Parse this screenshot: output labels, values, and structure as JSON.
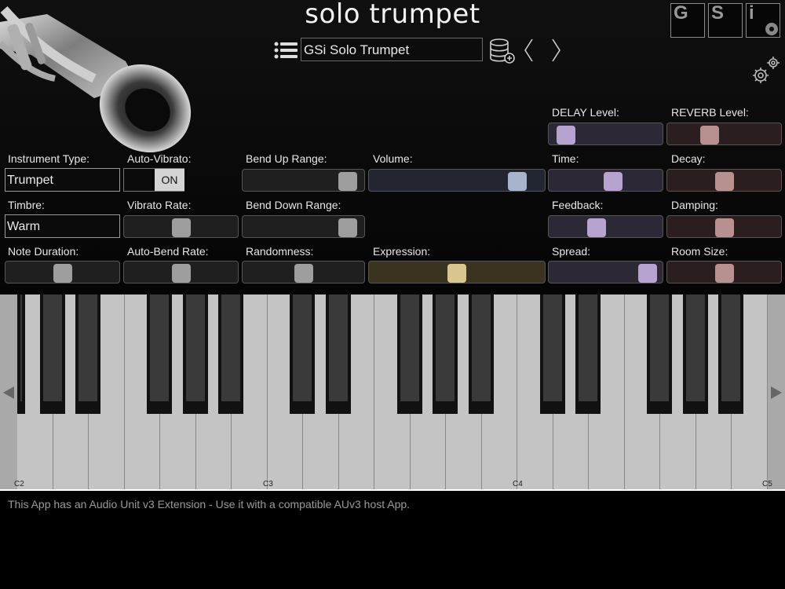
{
  "header": {
    "title": "solo trumpet",
    "preset_name": "GSi Solo Trumpet",
    "icons": {
      "menu": "list-icon",
      "presets": "database-add-icon",
      "prev": "chevron-left-icon",
      "next": "chevron-right-icon",
      "settings": "gears-icon"
    },
    "logo_letters": [
      "G",
      "S",
      "i"
    ]
  },
  "controls": {
    "instrument_type": {
      "label": "Instrument Type:",
      "value": "Trumpet"
    },
    "auto_vibrato": {
      "label": "Auto-Vibrato:",
      "state": "ON"
    },
    "bend_up": {
      "label": "Bend Up Range:",
      "level": 0.96
    },
    "volume": {
      "label": "Volume:",
      "level": 0.9
    },
    "timbre": {
      "label": "Timbre:",
      "value": "Warm"
    },
    "vibrato_rate": {
      "label": "Vibrato Rate:",
      "level": 0.5
    },
    "bend_down": {
      "label": "Bend Down Range:",
      "level": 0.96
    },
    "note_duration": {
      "label": "Note Duration:",
      "level": 0.5
    },
    "auto_bend_rate": {
      "label": "Auto-Bend Rate:",
      "level": 0.5
    },
    "randomness": {
      "label": "Randomness:",
      "level": 0.5
    },
    "expression": {
      "label": "Expression:",
      "level": 0.5
    }
  },
  "effects": {
    "delay_level": {
      "label": "DELAY Level:",
      "level": 0.05
    },
    "reverb_level": {
      "label": "REVERB Level:",
      "level": 0.34
    },
    "time": {
      "label": "Time:",
      "level": 0.58
    },
    "decay": {
      "label": "Decay:",
      "level": 0.5
    },
    "feedback": {
      "label": "Feedback:",
      "level": 0.4
    },
    "damping": {
      "label": "Damping:",
      "level": 0.5
    },
    "spread": {
      "label": "Spread:",
      "level": 0.97
    },
    "room_size": {
      "label": "Room Size:",
      "level": 0.5
    }
  },
  "colors": {
    "delay_track": "#2c2836",
    "delay_knob": "#b7a3cf",
    "reverb_track": "#2a1e1e",
    "reverb_knob": "#b99090",
    "volume_track": "#232630",
    "volume_knob": "#a8b3cc",
    "expression_track": "#3a3320",
    "expression_knob": "#d9c68e",
    "gray_track": "#1f1f1f",
    "gray_knob": "#9e9e9e"
  },
  "keyboard": {
    "octave_labels": [
      "C2",
      "C3",
      "C4",
      "C5"
    ],
    "scroll_left": "triangle-left-icon",
    "scroll_right": "triangle-right-icon"
  },
  "footer": {
    "text": "This App has an Audio Unit v3 Extension - Use it with a compatible AUv3 host App."
  }
}
